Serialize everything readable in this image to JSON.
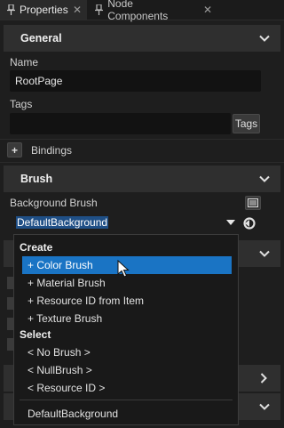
{
  "tabs": [
    {
      "label": "Properties",
      "close": "✕"
    },
    {
      "label": "Node Components",
      "close": "✕"
    }
  ],
  "general": {
    "title": "General",
    "name_label": "Name",
    "name_value": "RootPage",
    "tags_label": "Tags",
    "tags_value": "",
    "tags_button": "Tags",
    "bindings_label": "Bindings",
    "bindings_add": "+"
  },
  "brush": {
    "title": "Brush",
    "background_label": "Background Brush",
    "selected_value": "DefaultBackground"
  },
  "dropdown": {
    "create_header": "Create",
    "create_items": [
      "+ Color Brush",
      "+ Material Brush",
      "+ Resource ID from Item",
      "+ Texture Brush"
    ],
    "selected_index": 0,
    "select_header": "Select",
    "select_items": [
      "< No Brush >",
      "< NullBrush >",
      "< Resource ID >"
    ],
    "footer_item": "DefaultBackground"
  },
  "colors": {
    "accent": "#1a74c4",
    "panel": "#2f2f2f",
    "background": "#1e1e1e"
  },
  "icons": [
    "pin-icon",
    "chevron-down-icon",
    "chevron-right-icon",
    "plus-icon",
    "brush-editor-icon",
    "reset-icon",
    "dropdown-arrow-icon",
    "mouse-cursor-icon"
  ]
}
